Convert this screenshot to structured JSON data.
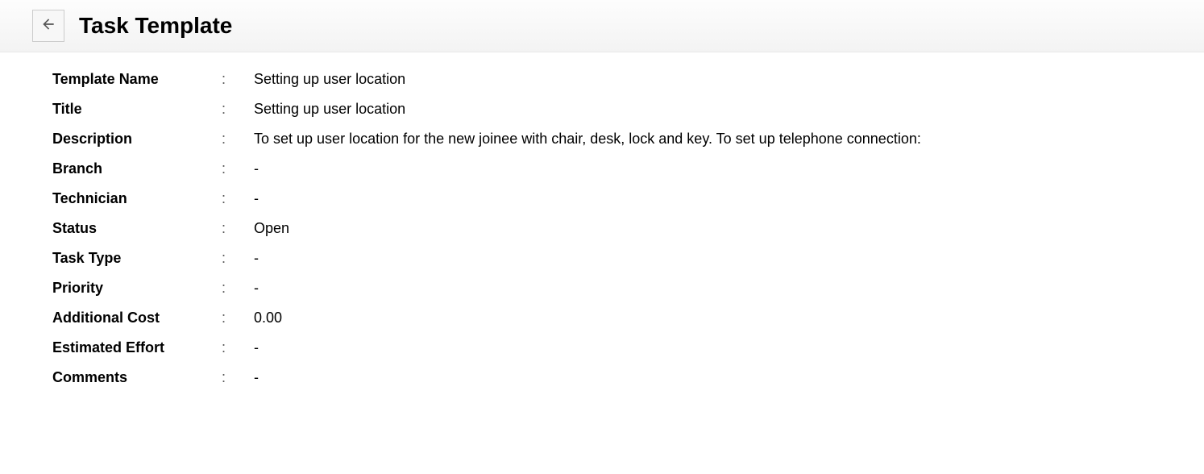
{
  "header": {
    "title": "Task Template"
  },
  "fields": {
    "template_name": {
      "label": "Template Name",
      "value": "Setting up user location"
    },
    "title": {
      "label": "Title",
      "value": "Setting up user location"
    },
    "description": {
      "label": "Description",
      "value": "To set up user location for the new joinee with chair, desk, lock and key. To set up telephone connection:"
    },
    "branch": {
      "label": "Branch",
      "value": "-"
    },
    "technician": {
      "label": "Technician",
      "value": "-"
    },
    "status": {
      "label": "Status",
      "value": "Open"
    },
    "task_type": {
      "label": "Task Type",
      "value": "-"
    },
    "priority": {
      "label": "Priority",
      "value": "-"
    },
    "additional_cost": {
      "label": "Additional Cost",
      "value": "0.00"
    },
    "estimated_effort": {
      "label": "Estimated Effort",
      "value": "-"
    },
    "comments": {
      "label": "Comments",
      "value": "-"
    }
  },
  "separator": ":"
}
